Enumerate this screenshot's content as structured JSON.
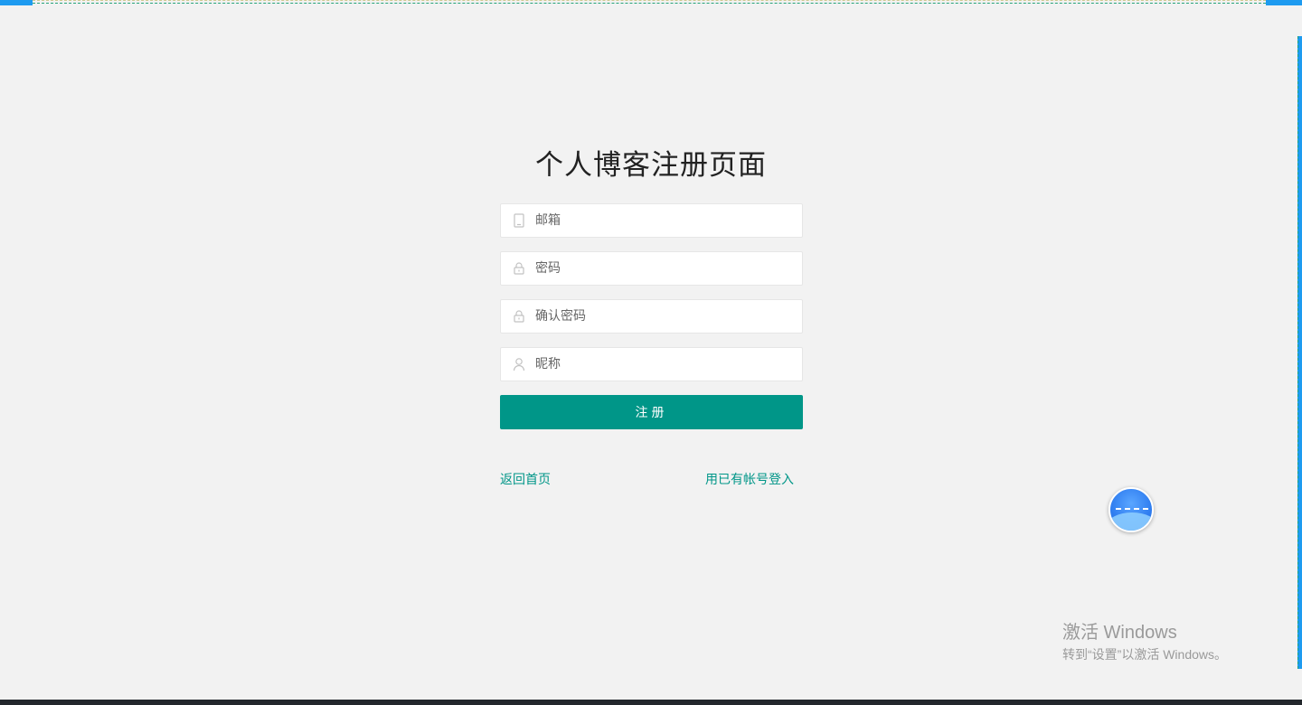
{
  "page": {
    "title": "个人博客注册页面"
  },
  "form": {
    "email": {
      "placeholder": "邮箱",
      "icon": "cellphone-icon"
    },
    "password": {
      "placeholder": "密码",
      "icon": "lock-icon"
    },
    "confirm_password": {
      "placeholder": "确认密码",
      "icon": "lock-icon"
    },
    "nickname": {
      "placeholder": "昵称",
      "icon": "user-icon"
    },
    "submit_label": "注册"
  },
  "links": {
    "back_home": "返回首页",
    "login_existing": "用已有帐号登入"
  },
  "watermark": {
    "line1": "激活 Windows",
    "line2": "转到“设置”以激活 Windows。"
  },
  "colors": {
    "accent": "#009688",
    "background": "#f2f2f2",
    "frame_blue": "#1e9bf0"
  }
}
